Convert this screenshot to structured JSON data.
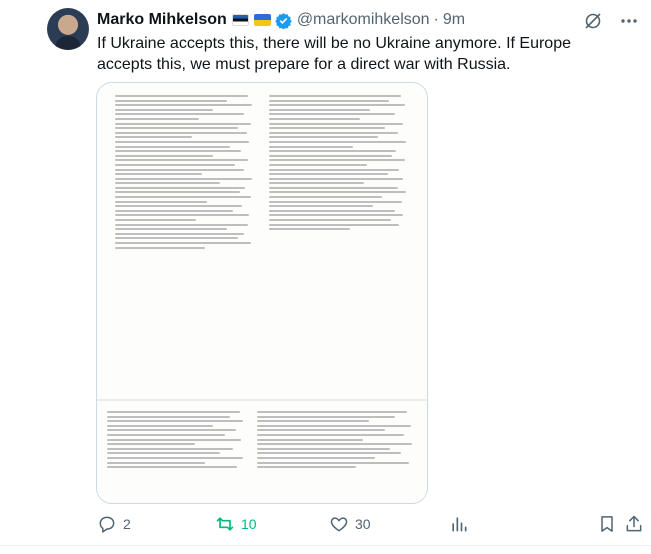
{
  "author": {
    "name": "Marko Mihkelson",
    "handle": "@markomihkelson",
    "separator": "·",
    "time": "9m"
  },
  "tweet": {
    "text": "If Ukraine accepts this, there will be no Ukraine anymore. If Europe accepts this, we must prepare for a direct war with Russia."
  },
  "icons": {
    "avatar": "profile-photo",
    "flag_1": "estonia-flag",
    "flag_2": "ukraine-flag",
    "verified": "verified-badge-icon",
    "grok": "grok-icon",
    "more": "more-icon"
  },
  "actions": {
    "reply_count": "2",
    "retweet_count": "10",
    "like_count": "30"
  },
  "colors": {
    "retweet_active": "#00ba7c",
    "verified": "#1d9bf0",
    "muted": "#536471"
  }
}
